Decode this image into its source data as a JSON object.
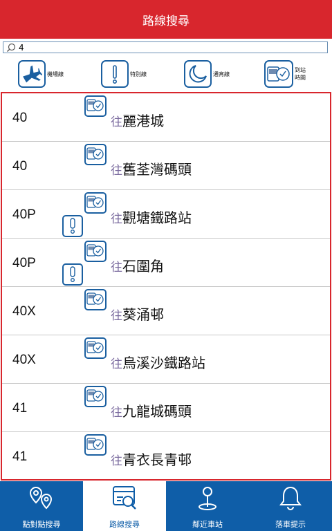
{
  "header": {
    "title": "路線搜尋"
  },
  "search": {
    "value": "4"
  },
  "categories": [
    {
      "label": "機場線",
      "icon": "airplane-icon"
    },
    {
      "label": "特別線",
      "icon": "exclamation-icon"
    },
    {
      "label": "通宵線",
      "icon": "moon-icon"
    },
    {
      "label": "到站\n時間",
      "icon": "arrival-time-icon"
    }
  ],
  "routes": [
    {
      "number": "40",
      "to_prefix": "往",
      "destination": "麗港城",
      "special": false
    },
    {
      "number": "40",
      "to_prefix": "往",
      "destination": "舊荃灣碼頭",
      "special": false
    },
    {
      "number": "40P",
      "to_prefix": "往",
      "destination": "觀塘鐵路站",
      "special": true
    },
    {
      "number": "40P",
      "to_prefix": "往",
      "destination": "石圍角",
      "special": true
    },
    {
      "number": "40X",
      "to_prefix": "往",
      "destination": "葵涌邨",
      "special": false
    },
    {
      "number": "40X",
      "to_prefix": "往",
      "destination": "烏溪沙鐵路站",
      "special": false
    },
    {
      "number": "41",
      "to_prefix": "往",
      "destination": "九龍城碼頭",
      "special": false
    },
    {
      "number": "41",
      "to_prefix": "往",
      "destination": "青衣長青邨",
      "special": false
    }
  ],
  "tabs": [
    {
      "label": "點對點搜尋",
      "icon": "map-pins-icon",
      "active": false
    },
    {
      "label": "路線搜尋",
      "icon": "route-search-icon",
      "active": true
    },
    {
      "label": "鄰近車站",
      "icon": "location-pin-icon",
      "active": false
    },
    {
      "label": "落車提示",
      "icon": "bell-icon",
      "active": false
    }
  ],
  "colors": {
    "brand_red": "#d8262d",
    "brand_blue": "#0f5ea8",
    "icon_blue": "#1a5fa0"
  }
}
